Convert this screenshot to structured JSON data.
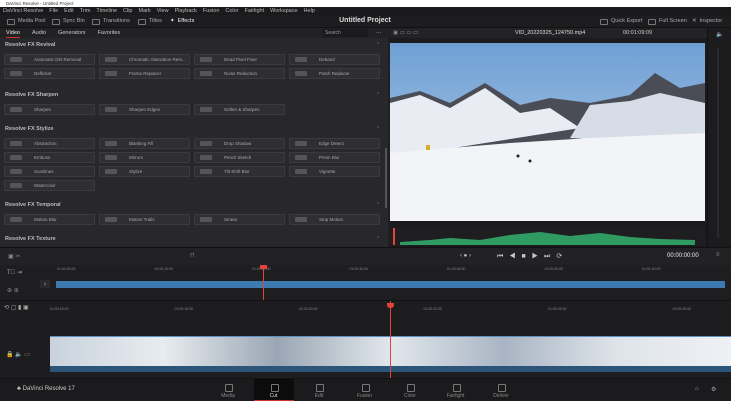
{
  "window_title": "DaVinci Resolve - Untitled Project",
  "menu": [
    "DaVinci Resolve",
    "File",
    "Edit",
    "Trim",
    "Timeline",
    "Clip",
    "Mark",
    "View",
    "Playback",
    "Fusion",
    "Color",
    "Fairlight",
    "Workspace",
    "Help"
  ],
  "toolbar": {
    "media_pool": "Media Pool",
    "sync_bin": "Sync Bin",
    "transitions": "Transitions",
    "titles": "Titles",
    "effects": "Effects",
    "project_title": "Untitled Project",
    "quick_export": "Quick Export",
    "full_screen": "Full Screen",
    "inspector": "Inspector"
  },
  "effects": {
    "tabs": [
      "Video",
      "Audio",
      "Generators",
      "Favorites"
    ],
    "search_placeholder": "Search",
    "sections": [
      {
        "title": "Resolve FX Revival",
        "items": [
          "Automatic Dirt Removal",
          "Chromatic Aberration Rem...",
          "Dead Pixel Fixer",
          "Deband",
          "Deflicker",
          "Frame Replacer",
          "Noise Reduction",
          "Patch Replacer"
        ]
      },
      {
        "title": "Resolve FX Sharpen",
        "items": [
          "Sharpen",
          "Sharpen Edges",
          "Soften & Sharpen"
        ]
      },
      {
        "title": "Resolve FX Stylize",
        "items": [
          "Abstraction",
          "Blanking Fill",
          "Drop Shadow",
          "Edge Detect",
          "Emboss",
          "Mirrors",
          "Pencil Sketch",
          "Prism Blur",
          "Scanlines",
          "Stylize",
          "Tilt-Shift Blur",
          "Vignette",
          "Watercolor"
        ]
      },
      {
        "title": "Resolve FX Temporal",
        "items": [
          "Motion Blur",
          "Motion Trails",
          "Smear",
          "Stop Motion"
        ]
      },
      {
        "title": "Resolve FX Texture",
        "items": []
      }
    ]
  },
  "viewer": {
    "clip_name": "VID_20220325_124750.mp4",
    "source_timecode": "00:01:09:09",
    "playhead_timecode": "00:00:00:00"
  },
  "timeline": {
    "upper_ruler": [
      "01:00:00:00",
      "01:00:10:00",
      "01:00:20:00",
      "01:00:30:00",
      "01:00:40:00",
      "01:00:50:00",
      "01:01:00:00"
    ],
    "lower_ruler": [
      "01:00:16:00",
      "01:00:18:00",
      "01:00:20:00",
      "01:00:22:00",
      "01:00:24:00",
      "01:00:26:00"
    ],
    "track_number": "1",
    "clip_color": "#3d7ab0",
    "playhead_color": "#e0443a"
  },
  "bottom": {
    "app": "DaVinci Resolve 17",
    "pages": [
      "Media",
      "Cut",
      "Edit",
      "Fusion",
      "Color",
      "Fairlight",
      "Deliver"
    ],
    "active_page": "Cut"
  }
}
